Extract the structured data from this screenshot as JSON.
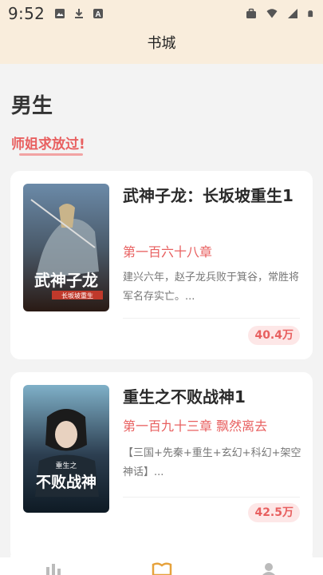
{
  "status_bar": {
    "time": "9:52",
    "left_icons": [
      "image-icon",
      "download-icon",
      "a-box-icon"
    ],
    "right_icons": [
      "briefcase-icon",
      "wifi-icon",
      "signal-icon",
      "battery-icon"
    ]
  },
  "header": {
    "title": "书城"
  },
  "section": {
    "title": "男生",
    "active_tab": "师姐求放过!"
  },
  "books": [
    {
      "title": "武神子龙：长坂坡重生1",
      "chapter": "第一百六十八章",
      "description": "建兴六年，赵子龙兵败于箕谷，常胜将军名存实亡。...",
      "count": "40.4万",
      "cover_text": "武神子龙",
      "cover_sub": "长坂坡重生"
    },
    {
      "title": "重生之不败战神1",
      "chapter": "第一百九十三章 飘然离去",
      "description": "【三国+先秦+重生+玄幻+科幻+架空神话】...",
      "count": "42.5万",
      "cover_text": "不败战神",
      "cover_sub": "重生之"
    }
  ],
  "colors": {
    "accent": "#e86060",
    "header_bg": "#f9eddc",
    "page_bg": "#f3f3f3"
  }
}
